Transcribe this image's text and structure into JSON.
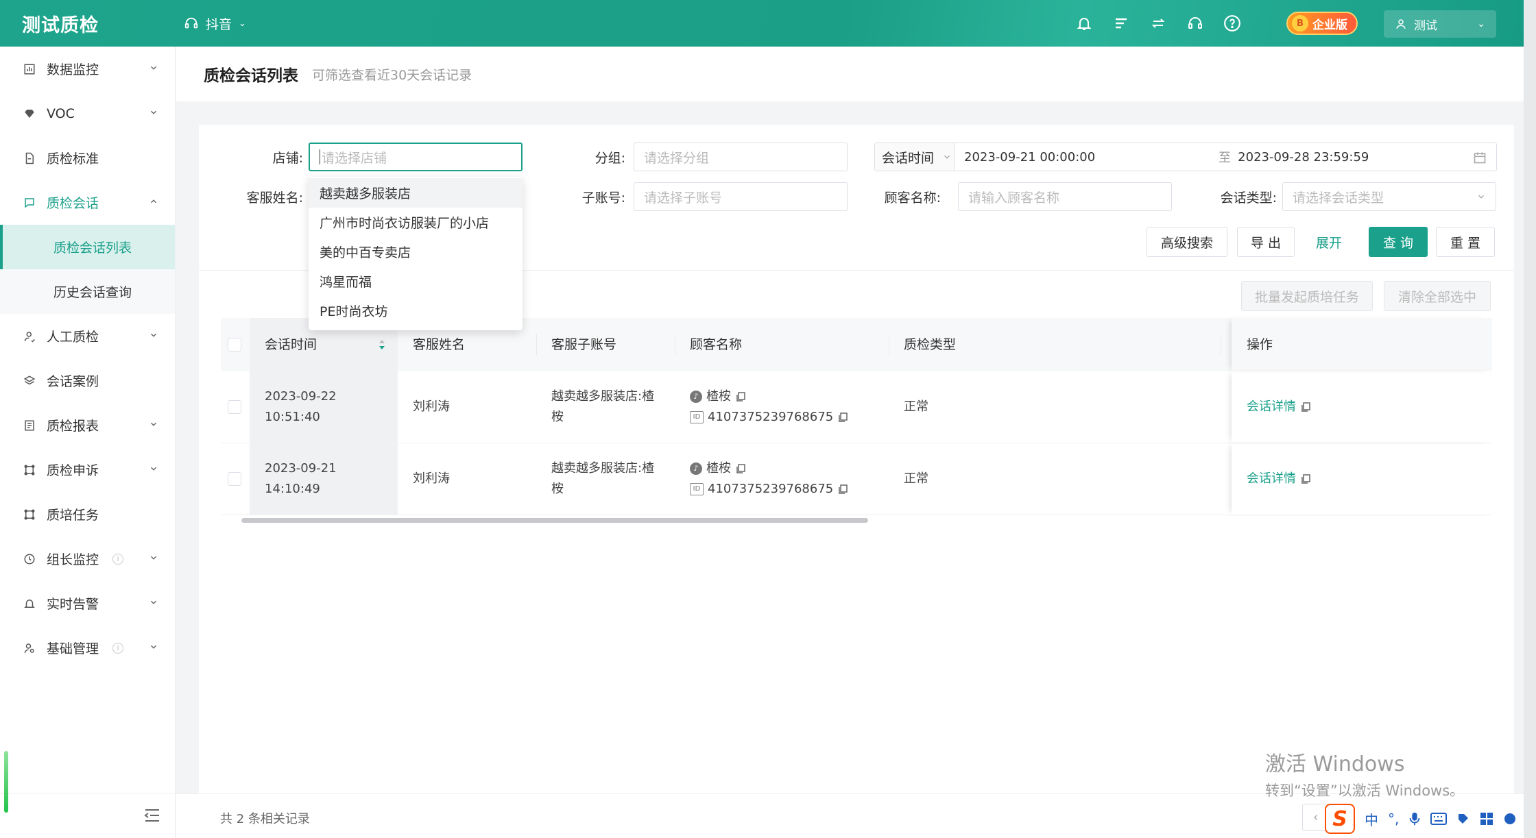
{
  "header": {
    "logo": "测试质检",
    "platform": "抖音",
    "badge": "企业版",
    "user": "测试",
    "icons": [
      "bell-icon",
      "list-icon",
      "swap-icon",
      "headset-icon",
      "help-icon"
    ]
  },
  "sidebar": {
    "items": [
      {
        "label": "数据监控",
        "icon": "chart-icon",
        "expand": "down"
      },
      {
        "label": "VOC",
        "icon": "diamond-icon",
        "expand": "down"
      },
      {
        "label": "质检标准",
        "icon": "doc-icon",
        "expand": ""
      },
      {
        "label": "质检会话",
        "icon": "chat-icon",
        "expand": "up",
        "active": true
      },
      {
        "label": "人工质检",
        "icon": "person-icon",
        "expand": "down"
      },
      {
        "label": "会话案例",
        "icon": "layers-icon",
        "expand": ""
      },
      {
        "label": "质检报表",
        "icon": "report-icon",
        "expand": "down"
      },
      {
        "label": "质检申诉",
        "icon": "appeal-icon",
        "expand": "down"
      },
      {
        "label": "质培任务",
        "icon": "task-icon",
        "expand": ""
      },
      {
        "label": "组长监控",
        "icon": "clock-icon",
        "expand": "down",
        "info": true
      },
      {
        "label": "实时告警",
        "icon": "alarm-icon",
        "expand": "down"
      },
      {
        "label": "基础管理",
        "icon": "manage-icon",
        "expand": "down",
        "info": true
      }
    ],
    "sub_items": [
      {
        "label": "质检会话列表",
        "active": true
      },
      {
        "label": "历史会话查询",
        "active": false
      }
    ]
  },
  "page": {
    "title": "质检会话列表",
    "subtitle": "可筛选查看近30天会话记录"
  },
  "filters": {
    "shop_label": "店铺:",
    "shop_placeholder": "请选择店铺",
    "group_label": "分组:",
    "group_placeholder": "请选择分组",
    "date_type": "会话时间",
    "date_start": "2023-09-21 00:00:00",
    "date_sep": "至",
    "date_end": "2023-09-28 23:59:59",
    "agent_label": "客服姓名:",
    "subacct_label": "子账号:",
    "subacct_placeholder": "请选择子账号",
    "customer_label": "顾客名称:",
    "customer_placeholder": "请输入顾客名称",
    "type_label": "会话类型:",
    "type_placeholder": "请选择会话类型"
  },
  "buttons": {
    "advanced": "高级搜索",
    "export": "导 出",
    "expand": "展开",
    "query": "查 询",
    "reset": "重 置",
    "batch": "批量发起质培任务",
    "clear": "清除全部选中"
  },
  "shop_dropdown": [
    "越卖越多服装店",
    "广州市时尚衣访服装厂的小店",
    "美的中百专卖店",
    "鸿星而福",
    "PE时尚衣坊"
  ],
  "table": {
    "columns": [
      "会话时间",
      "客服姓名",
      "客服子账号",
      "顾客名称",
      "质检类型",
      "操作"
    ],
    "rows": [
      {
        "date": "2023-09-22",
        "time": "10:51:40",
        "agent": "刘利涛",
        "sub_a": "越卖越多服装店:楂",
        "sub_b": "桉",
        "customer": "楂桉",
        "customer_id": "4107375239768675",
        "type": "正常",
        "action": "会话详情"
      },
      {
        "date": "2023-09-21",
        "time": "14:10:49",
        "agent": "刘利涛",
        "sub_a": "越卖越多服装店:楂",
        "sub_b": "桉",
        "customer": "楂桉",
        "customer_id": "4107375239768675",
        "type": "正常",
        "action": "会话详情"
      }
    ]
  },
  "footer": {
    "total": "共 2 条相关记录"
  },
  "watermark": {
    "line1": "激活 Windows",
    "line2": "转到“设置”以激活 Windows。"
  },
  "ime": {
    "lang": "中",
    "punct": "°,"
  },
  "colors": {
    "accent": "#1aa08b",
    "header": "#1ea48c",
    "badge": "#ff6a2f"
  }
}
